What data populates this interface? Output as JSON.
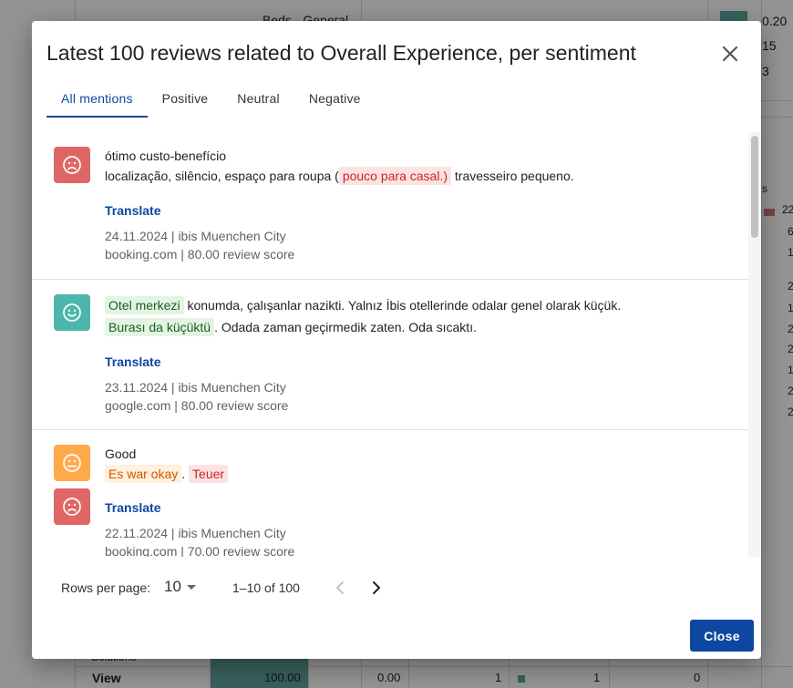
{
  "background": {
    "top_label": "Beds - General",
    "right_values": [
      "0.20",
      "15",
      "3"
    ],
    "right_col2": [
      "22",
      "6",
      "1",
      "2",
      "1",
      "2",
      "2",
      "1",
      "2",
      "2"
    ],
    "header_fragment": "s",
    "bottom_row1": "Solutions",
    "bottom_row2": {
      "label": "View",
      "v1": "100.00",
      "v2": "0.00",
      "v3": "1",
      "v4": "1",
      "v5": "0"
    }
  },
  "dialog": {
    "title": "Latest 100 reviews related to Overall Experience, per sentiment",
    "tabs": [
      "All mentions",
      "Positive",
      "Neutral",
      "Negative"
    ],
    "active_tab": 0,
    "translate_label": "Translate",
    "reviews": [
      {
        "sentiment": "negative",
        "line1": "ótimo custo-benefício",
        "line2_pre": "localização, silêncio, espaço para roupa (",
        "line2_hl": "pouco para casal.)",
        "line2_post": " travesseiro pequeno.",
        "date_hotel": "24.11.2024 | ibis Muenchen City",
        "source_score": "booking.com | 80.00 review score"
      },
      {
        "sentiment": "positive",
        "hl1": "Otel merkezi",
        "line1_post": " konumda, çalışanlar nazikti. Yalnız İbis otellerinde odalar genel olarak küçük.",
        "hl2": "Burası da küçüktü",
        "line2_post": ". Odada zaman geçirmedik zaten. Oda sıcaktı.",
        "date_hotel": "23.11.2024 | ibis Muenchen City",
        "source_score": "google.com | 80.00 review score"
      },
      {
        "sentiment": "neutral",
        "sentiment2": "negative",
        "line1": "Good",
        "hl1": "Es war okay",
        "sep": ".",
        "hl2": "Teuer",
        "date_hotel": "22.11.2024 | ibis Muenchen City",
        "source_score": "booking.com | 70.00 review score"
      }
    ],
    "pager": {
      "rows_label": "Rows per page:",
      "rows_value": "10",
      "range": "1–10 of 100"
    },
    "close_label": "Close"
  }
}
